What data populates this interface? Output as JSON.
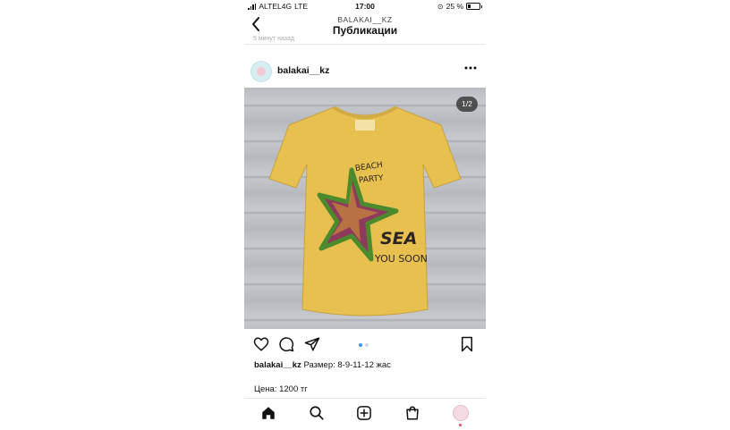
{
  "status_bar": {
    "carrier": "ALTEL4G",
    "network": "LTE",
    "time": "17:00",
    "battery": "25 %"
  },
  "header": {
    "account": "BALAKAI__KZ",
    "title": "Публикации",
    "back_icon": "chevron-left-icon"
  },
  "previous_post_time": "5 минут назад",
  "post": {
    "username": "balakai__kz",
    "more_icon": "more-horizontal-icon",
    "image": {
      "counter": "1/2",
      "print_text": [
        "BEACH",
        "PARTY",
        "SEA",
        "YOU SOON"
      ],
      "shirt_color": "#e8c04f"
    },
    "actions": {
      "like_icon": "heart-icon",
      "comment_icon": "comment-icon",
      "share_icon": "send-icon",
      "save_icon": "bookmark-icon"
    },
    "carousel": {
      "total": 2,
      "active": 1
    },
    "caption": {
      "username": "balakai__kz",
      "text": "Размер: 8-9-11-12 жас"
    },
    "price": "Цена: 1200 тг"
  },
  "tab_bar": [
    "home-icon",
    "search-icon",
    "add-post-icon",
    "shop-icon",
    "profile-avatar"
  ],
  "colors": {
    "accent_blue": "#3897f0",
    "notification_red": "#ed4956",
    "shirt_yellow": "#e8c04f"
  }
}
